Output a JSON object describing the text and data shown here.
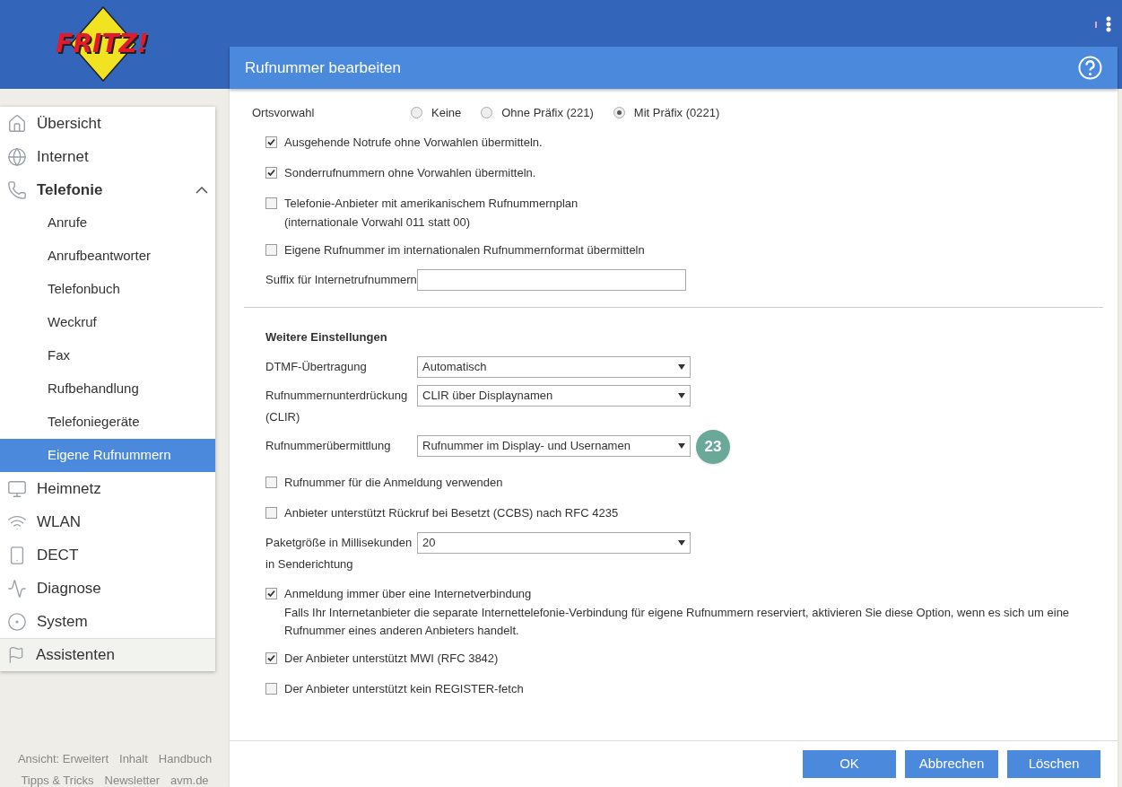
{
  "header": {
    "logo": "FRITZ!"
  },
  "sidebar": {
    "items": [
      {
        "label": "Übersicht",
        "selected": false
      },
      {
        "label": "Internet",
        "selected": false
      },
      {
        "label": "Telefonie",
        "selected": false,
        "expanded": true,
        "children": [
          {
            "label": "Anrufe",
            "selected": false
          },
          {
            "label": "Anrufbeantworter",
            "selected": false
          },
          {
            "label": "Telefonbuch",
            "selected": false
          },
          {
            "label": "Weckruf",
            "selected": false
          },
          {
            "label": "Fax",
            "selected": false
          },
          {
            "label": "Rufbehandlung",
            "selected": false
          },
          {
            "label": "Telefoniegeräte",
            "selected": false
          },
          {
            "label": "Eigene Rufnummern",
            "selected": true
          }
        ]
      },
      {
        "label": "Heimnetz",
        "selected": false
      },
      {
        "label": "WLAN",
        "selected": false
      },
      {
        "label": "DECT",
        "selected": false
      },
      {
        "label": "Diagnose",
        "selected": false
      },
      {
        "label": "System",
        "selected": false
      }
    ],
    "wizard": {
      "label": "Assistenten"
    }
  },
  "footer_links": [
    [
      "Ansicht: Erweitert",
      "Inhalt",
      "Handbuch"
    ],
    [
      "Tipps & Tricks",
      "Newsletter",
      "avm.de"
    ]
  ],
  "dialog": {
    "title": "Rufnummer bearbeiten",
    "settings": [
      {
        "kind": "radio",
        "label": "Ortsvorwahl",
        "options": [
          {
            "label": "Keine",
            "selected": false
          },
          {
            "label": "Ohne Präfix (221)",
            "selected": false
          },
          {
            "label": "Mit Präfix (0221)",
            "selected": true
          }
        ]
      },
      {
        "kind": "checkbox",
        "label": "Ausgehende Notrufe ohne Vorwahlen übermitteln.",
        "checked": true
      },
      {
        "kind": "checkbox",
        "label": "Sonderrufnummern ohne Vorwahlen übermitteln.",
        "checked": true
      },
      {
        "kind": "checkbox",
        "label": "Telefonie-Anbieter mit amerikanischem Rufnummernplan",
        "checked": false
      },
      {
        "kind": "note",
        "text": "(internationale Vorwahl 011 statt 00)"
      },
      {
        "kind": "checkbox",
        "label": "Eigene Rufnummer im internationalen Rufnummernformat übermitteln",
        "checked": false
      },
      {
        "kind": "text",
        "label": "Suffix für Internetrufnummern"
      },
      {
        "kind": "divider"
      },
      {
        "kind": "heading",
        "text": "Weitere Einstellungen"
      },
      {
        "kind": "select",
        "label": "DTMF-Übertragung",
        "value": "Automatisch"
      },
      {
        "kind": "select",
        "label": "Rufnummernunterdrückung (CLIR)",
        "value": "CLIR über Displaynamen"
      },
      {
        "kind": "select",
        "label": "Rufnummerübermittlung",
        "value": "Rufnummer im Display- und Usernamen",
        "badge": "23"
      },
      {
        "kind": "checkbox",
        "label": "Rufnummer für die Anmeldung verwenden",
        "checked": false
      },
      {
        "kind": "checkbox",
        "label": "Anbieter unterstützt Rückruf bei Besetzt (CCBS) nach RFC 4235",
        "checked": false
      },
      {
        "kind": "select",
        "label": "Paketgröße in Millisekunden in Senderichtung",
        "value": "20"
      },
      {
        "kind": "checkbox",
        "label": "Anmeldung immer über eine Internetverbindung",
        "checked": true
      },
      {
        "kind": "note",
        "text": "Falls Ihr Internetanbieter die separate Internettelefonie-Verbindung für eigene Rufnummern reserviert, aktivieren Sie diese Option, wenn es sich um eine Rufnummer eines anderen Anbieters handelt."
      },
      {
        "kind": "checkbox",
        "label": "Der Anbieter unterstützt MWI (RFC 3842)",
        "checked": true
      },
      {
        "kind": "checkbox",
        "label": "Der Anbieter unterstützt kein REGISTER-fetch",
        "checked": false
      }
    ],
    "buttons": [
      "OK",
      "Abbrechen",
      "Löschen"
    ]
  }
}
